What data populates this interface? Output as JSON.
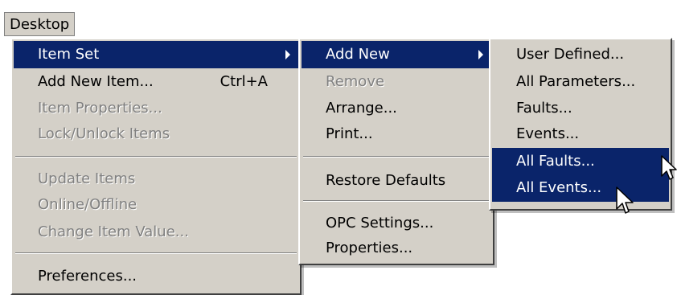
{
  "menubar": {
    "label": "Desktop"
  },
  "menu1": {
    "items": [
      {
        "label": "Item Set"
      },
      {
        "label": "Add New Item...",
        "shortcut": "Ctrl+A"
      },
      {
        "label": "Item Properties..."
      },
      {
        "label": "Lock/Unlock Items"
      },
      {
        "label": "Update Items"
      },
      {
        "label": "Online/Offline"
      },
      {
        "label": "Change Item Value..."
      },
      {
        "label": "Preferences..."
      }
    ]
  },
  "menu2": {
    "items": [
      {
        "label": "Add New"
      },
      {
        "label": "Remove"
      },
      {
        "label": "Arrange..."
      },
      {
        "label": "Print..."
      },
      {
        "label": "Restore Defaults"
      },
      {
        "label": "OPC Settings..."
      },
      {
        "label": "Properties..."
      }
    ]
  },
  "menu3": {
    "items": [
      {
        "label": "User Defined..."
      },
      {
        "label": "All Parameters..."
      },
      {
        "label": "Faults..."
      },
      {
        "label": "Events..."
      },
      {
        "label": "All Faults..."
      },
      {
        "label": "All Events..."
      }
    ]
  },
  "colors": {
    "menu_bg": "#d4d0c8",
    "highlight": "#0a246a",
    "disabled_text": "#808080"
  },
  "icons": [
    "submenu-arrow-icon",
    "mouse-pointer-icon"
  ]
}
